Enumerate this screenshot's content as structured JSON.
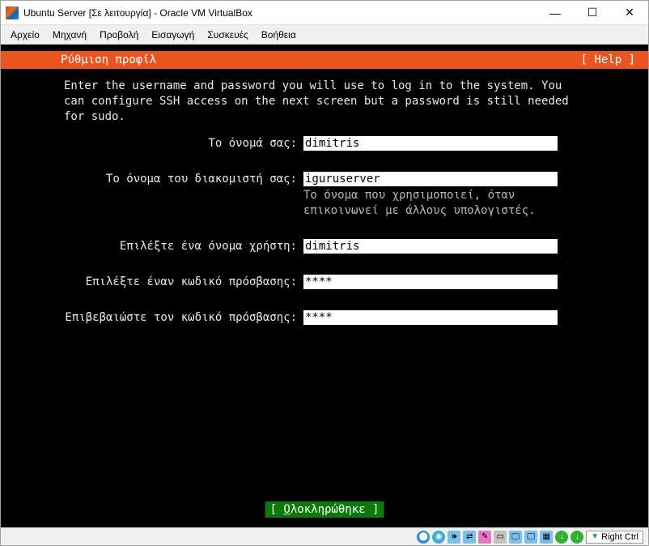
{
  "window": {
    "title": "Ubuntu Server [Σε λειτουργία] - Oracle VM VirtualBox"
  },
  "menubar": {
    "file": "Αρχείο",
    "machine": "Μηχανή",
    "view": "Προβολή",
    "input": "Εισαγωγή",
    "devices": "Συσκευές",
    "help": "Βοήθεια"
  },
  "installer": {
    "header_title": "Ρύθμιση προφίλ",
    "help_button": "[ Help ]",
    "instructions": "Enter the username and password you will use to log in to the system. You can configure SSH access on the next screen but a password is still needed for sudo.",
    "fields": {
      "your_name_label": "Το όνομά σας:",
      "your_name_value": "dimitris",
      "server_name_label": "Το όνομα του διακομιστή σας:",
      "server_name_value": "iguruserver",
      "server_name_hint": "Το όνομα που χρησιμοποιεί, όταν επικοινωνεί με άλλους υπολογιστές.",
      "username_label": "Επιλέξτε ένα όνομα χρήστη:",
      "username_value": "dimitris",
      "password_label": "Επιλέξτε έναν κωδικό πρόσβασης:",
      "password_value": "****",
      "confirm_label": "Επιβεβαιώστε τον κωδικό πρόσβασης:",
      "confirm_value": "****"
    },
    "done_label": "Ολοκληρώθηκε"
  },
  "statusbar": {
    "capture_key": "Right Ctrl"
  }
}
